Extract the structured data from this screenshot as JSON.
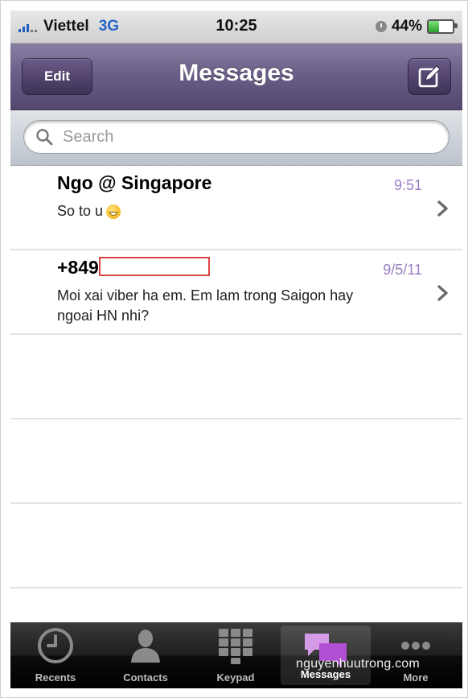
{
  "status_bar": {
    "carrier": "Viettel",
    "network": "3G",
    "time": "10:25",
    "battery_percent": "44%",
    "battery_level": 0.44
  },
  "nav": {
    "edit_label": "Edit",
    "title": "Messages",
    "compose_icon": "compose-icon"
  },
  "search": {
    "placeholder": "Search",
    "value": ""
  },
  "conversations": [
    {
      "name": "Ngo @ Singapore",
      "preview": "So to u",
      "date": "9:51",
      "emoji": "grinning-face"
    },
    {
      "name": "+849",
      "preview": "Moi xai viber ha em. Em lam trong Saigon hay ngoai HN nhi?",
      "date": "9/5/11"
    }
  ],
  "tabs": [
    {
      "label": "Recents",
      "icon": "clock-icon"
    },
    {
      "label": "Contacts",
      "icon": "person-icon"
    },
    {
      "label": "Keypad",
      "icon": "keypad-icon"
    },
    {
      "label": "Messages",
      "icon": "chat-bubbles-icon",
      "active": true
    },
    {
      "label": "More",
      "icon": "more-icon"
    }
  ],
  "watermark": "nguyenhuutrong.com",
  "colors": {
    "nav_purple": "#6b5f88",
    "date_purple": "#9b7fc0",
    "network_blue": "#2563c9",
    "redaction_red": "#dd4444"
  }
}
